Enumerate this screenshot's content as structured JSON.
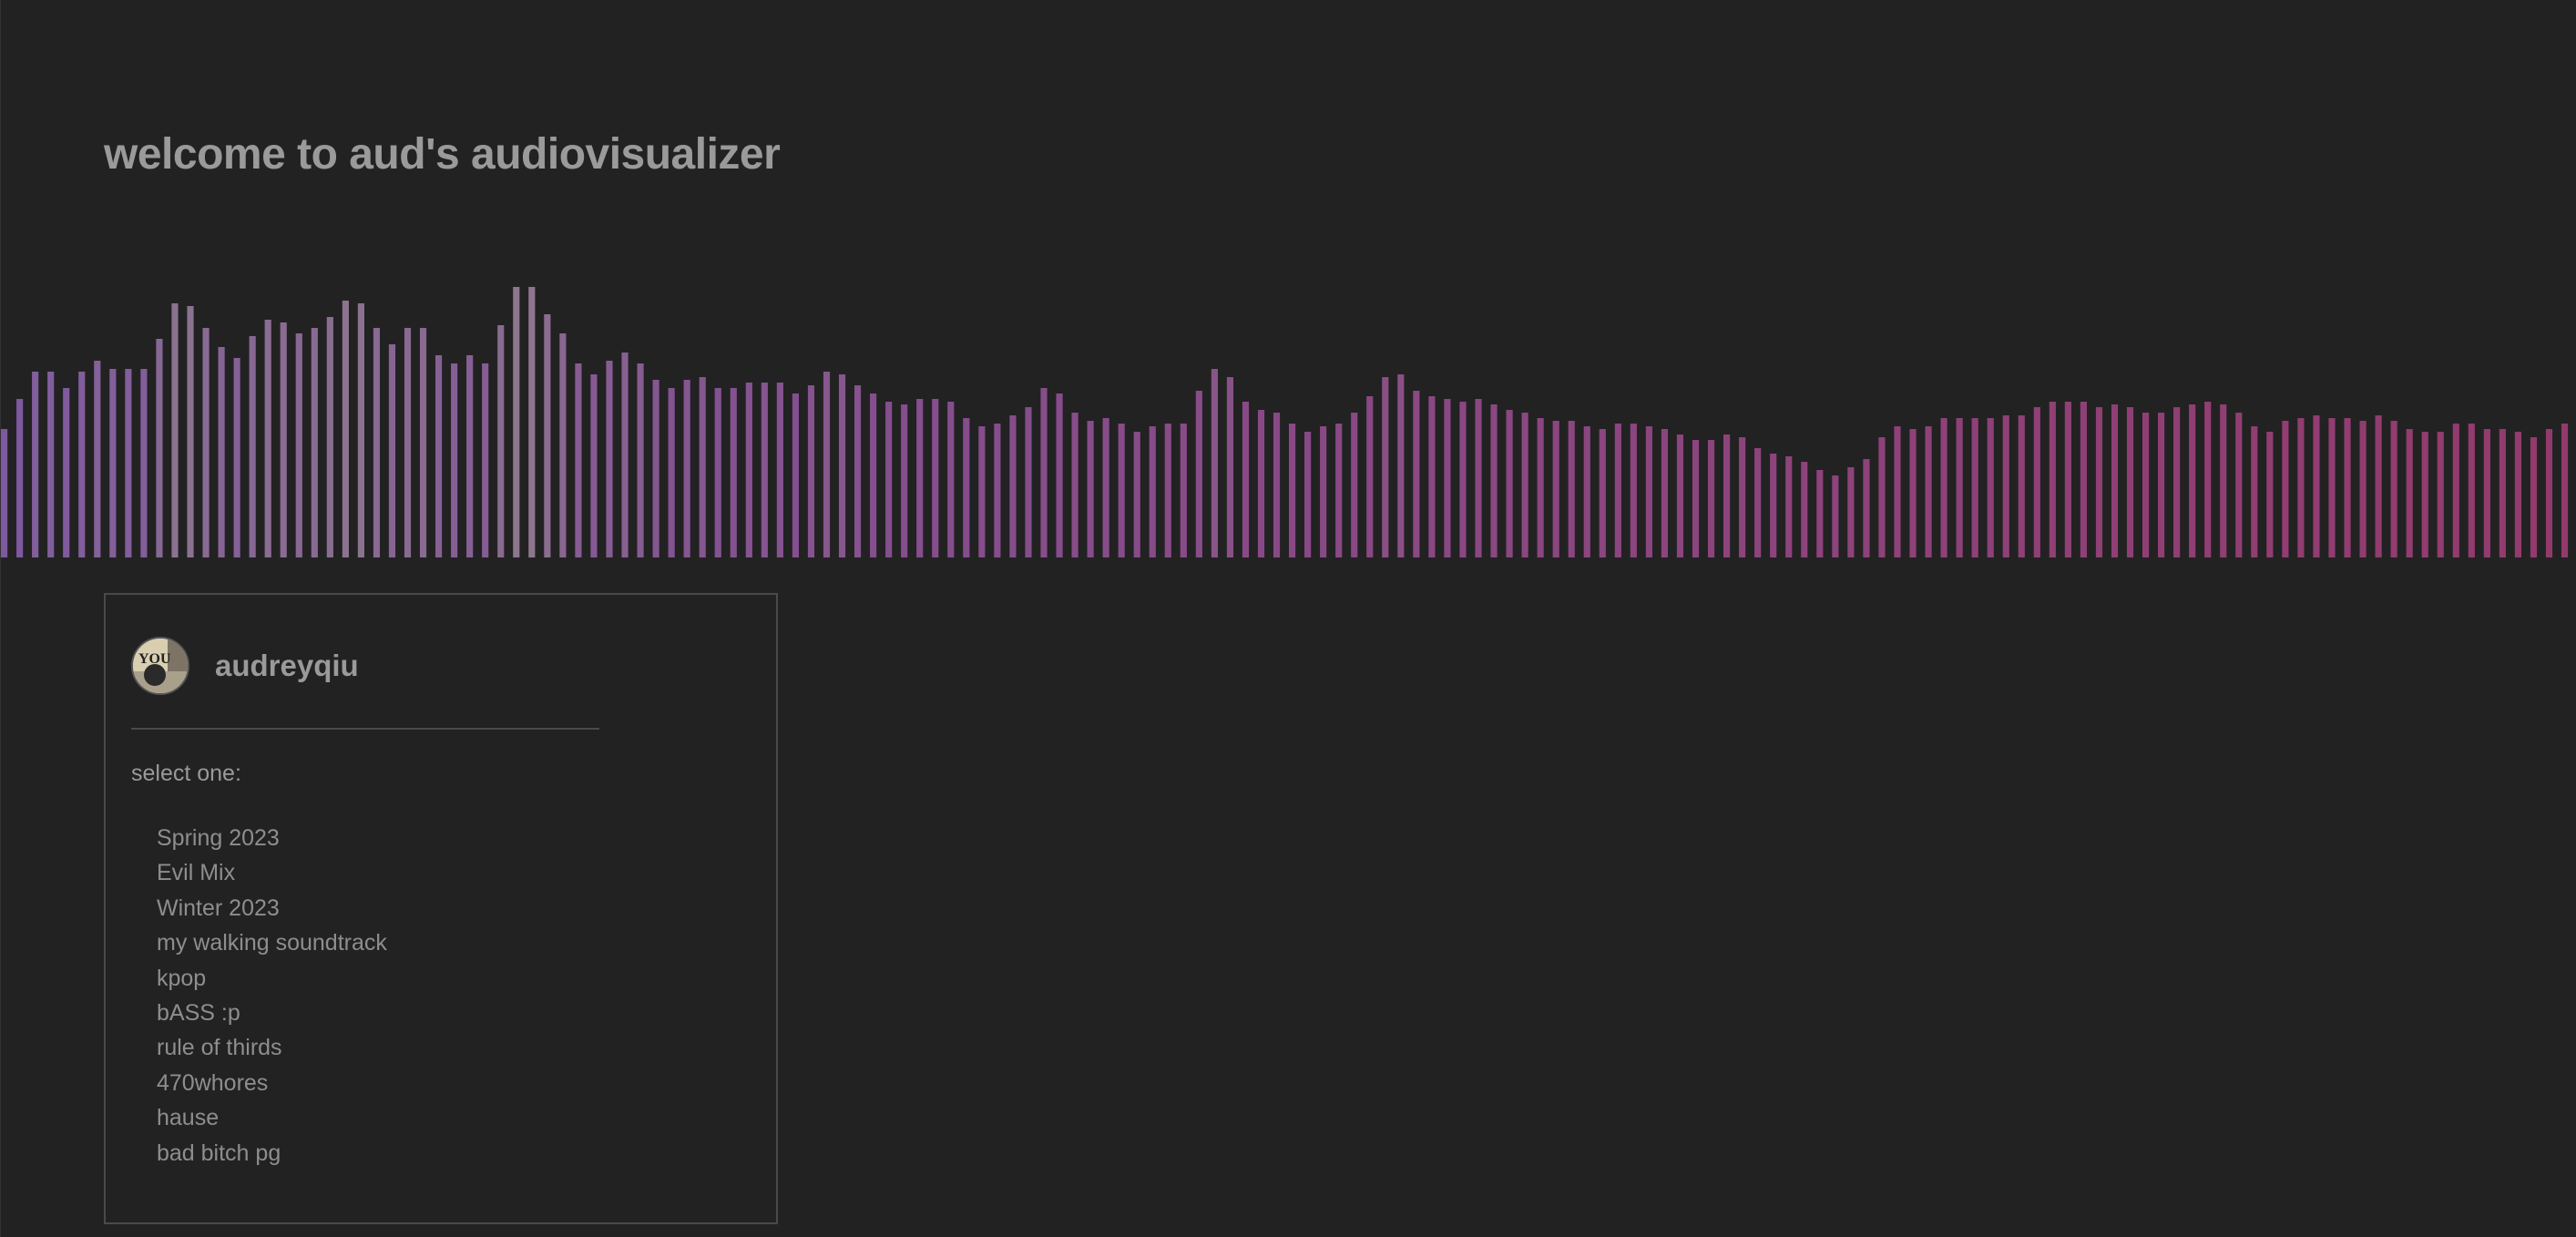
{
  "header": {
    "title": "welcome to aud's audiovisualizer"
  },
  "visualizer": {
    "bar_colors": {
      "start": "#7e59a0",
      "mid_light": "#8f7c8c",
      "end": "#933a6c"
    },
    "levels": [
      0.47,
      0.58,
      0.68,
      0.68,
      0.62,
      0.68,
      0.72,
      0.69,
      0.69,
      0.69,
      0.8,
      0.93,
      0.92,
      0.84,
      0.77,
      0.73,
      0.81,
      0.87,
      0.86,
      0.82,
      0.84,
      0.88,
      0.94,
      0.93,
      0.84,
      0.78,
      0.84,
      0.84,
      0.74,
      0.71,
      0.74,
      0.71,
      0.85,
      0.99,
      0.99,
      0.89,
      0.82,
      0.71,
      0.67,
      0.72,
      0.75,
      0.71,
      0.65,
      0.62,
      0.65,
      0.66,
      0.62,
      0.62,
      0.64,
      0.64,
      0.64,
      0.6,
      0.63,
      0.68,
      0.67,
      0.63,
      0.6,
      0.57,
      0.56,
      0.58,
      0.58,
      0.57,
      0.51,
      0.48,
      0.49,
      0.52,
      0.55,
      0.62,
      0.6,
      0.53,
      0.5,
      0.51,
      0.49,
      0.46,
      0.48,
      0.49,
      0.49,
      0.61,
      0.69,
      0.66,
      0.57,
      0.54,
      0.53,
      0.49,
      0.46,
      0.48,
      0.49,
      0.53,
      0.59,
      0.66,
      0.67,
      0.61,
      0.59,
      0.58,
      0.57,
      0.58,
      0.56,
      0.54,
      0.53,
      0.51,
      0.5,
      0.5,
      0.48,
      0.47,
      0.49,
      0.49,
      0.48,
      0.47,
      0.45,
      0.43,
      0.43,
      0.45,
      0.44,
      0.4,
      0.38,
      0.37,
      0.35,
      0.32,
      0.3,
      0.33,
      0.36,
      0.44,
      0.48,
      0.47,
      0.48,
      0.51,
      0.51,
      0.51,
      0.51,
      0.52,
      0.52,
      0.55,
      0.57,
      0.57,
      0.57,
      0.55,
      0.56,
      0.55,
      0.53,
      0.53,
      0.55,
      0.56,
      0.57,
      0.56,
      0.53,
      0.48,
      0.46,
      0.5,
      0.51,
      0.52,
      0.51,
      0.51,
      0.5,
      0.52,
      0.5,
      0.47,
      0.46,
      0.46,
      0.49,
      0.49,
      0.47,
      0.47,
      0.46,
      0.44,
      0.47,
      0.49
    ]
  },
  "profile": {
    "username": "audreyqiu",
    "avatar_text": "YOU"
  },
  "playlists": {
    "label": "select one:",
    "items": [
      "Spring 2023",
      "Evil Mix",
      "Winter 2023",
      "my walking soundtrack",
      "kpop",
      "bASS :p",
      "rule of thirds",
      "470whores",
      "hause",
      "bad bitch pg"
    ]
  }
}
